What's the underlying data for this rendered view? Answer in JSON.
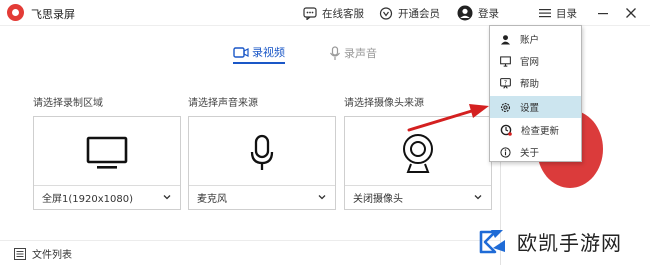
{
  "app": {
    "title": "飞思录屏"
  },
  "toolbar": {
    "online_service": "在线客服",
    "vip": "开通会员",
    "login": "登录",
    "catalog": "目录"
  },
  "tabs": [
    {
      "label": "录视频",
      "active": true
    },
    {
      "label": "录声音",
      "active": false
    }
  ],
  "sources": [
    {
      "label": "请选择录制区域",
      "value": "全屏1(1920x1080)",
      "icon": "monitor-icon"
    },
    {
      "label": "请选择声音来源",
      "value": "麦克风",
      "icon": "microphone-icon"
    },
    {
      "label": "请选择摄像头来源",
      "value": "关闭摄像头",
      "icon": "webcam-icon"
    }
  ],
  "footer": {
    "file_list": "文件列表"
  },
  "menu": {
    "items": [
      {
        "label": "账户",
        "icon": "account-icon",
        "selected": false
      },
      {
        "label": "官网",
        "icon": "website-icon",
        "selected": false
      },
      {
        "label": "帮助",
        "icon": "help-icon",
        "selected": false
      },
      {
        "label": "设置",
        "icon": "settings-icon",
        "selected": true
      },
      {
        "label": "检查更新",
        "icon": "update-icon",
        "selected": false
      },
      {
        "label": "关于",
        "icon": "info-icon",
        "selected": false
      }
    ]
  },
  "watermark": {
    "text": "欧凯手游网"
  },
  "colors": {
    "accent": "#1a57c7",
    "record": "#db3b3b",
    "brand": "#e33b36",
    "menu_selected": "#cce5ef",
    "arrow": "#d42020"
  }
}
